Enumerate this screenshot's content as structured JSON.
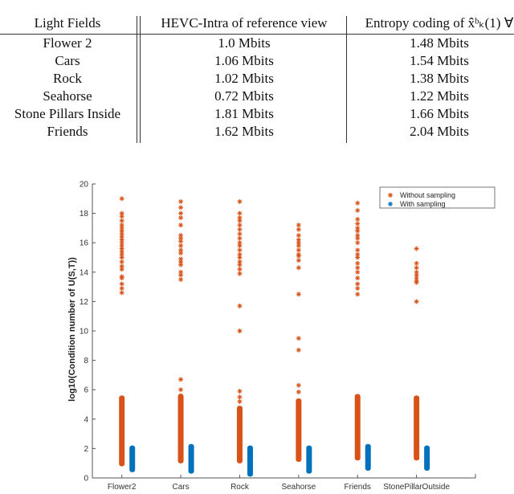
{
  "table": {
    "headers": [
      "Light Fields",
      "HEVC-Intra of reference view",
      "Entropy coding of x̂̂ᵇₖ(1) ∀"
    ],
    "rows": [
      [
        "Flower 2",
        "1.0 Mbits",
        "1.48 Mbits"
      ],
      [
        "Cars",
        "1.06 Mbits",
        "1.54 Mbits"
      ],
      [
        "Rock",
        "1.02 Mbits",
        "1.38 Mbits"
      ],
      [
        "Seahorse",
        "0.72 Mbits",
        "1.22 Mbits"
      ],
      [
        "Stone Pillars Inside",
        "1.81 Mbits",
        "1.66 Mbits"
      ],
      [
        "Friends",
        "1.62 Mbits",
        "2.04 Mbits"
      ]
    ]
  },
  "chart_data": {
    "type": "scatter",
    "title": "",
    "xlabel": "",
    "ylabel": "log10(Condition number of U(S,T))",
    "categories": [
      "Flower2",
      "Cars",
      "Rock",
      "Seahorse",
      "Friends",
      "StonePillarOutside"
    ],
    "xlim": [
      0.5,
      7
    ],
    "ylim": [
      0,
      20
    ],
    "yticks": [
      0,
      2,
      4,
      6,
      8,
      10,
      12,
      14,
      16,
      18,
      20
    ],
    "legend": {
      "placement": "top-right",
      "entries": [
        "Without sampling",
        "With sampling"
      ]
    },
    "colors": {
      "without": "#D95319",
      "with": "#0072BD",
      "axis": "#555555"
    },
    "series": [
      {
        "name": "Without sampling",
        "dense_ranges": [
          [
            0.9,
            5.5
          ],
          [
            1.1,
            5.6
          ],
          [
            1.1,
            4.8
          ],
          [
            1.2,
            5.3
          ],
          [
            1.3,
            5.6
          ],
          [
            1.3,
            5.5
          ]
        ],
        "outliers": [
          [
            19.0,
            18.0,
            17.8,
            17.5,
            17.2,
            17.0,
            16.8,
            16.6,
            16.4,
            16.2,
            16.0,
            15.8,
            15.6,
            15.4,
            15.2,
            15.0,
            14.7,
            14.4,
            14.2,
            13.7,
            13.6,
            13.2,
            12.9,
            12.6
          ],
          [
            18.8,
            18.4,
            18.0,
            17.7,
            17.2,
            16.5,
            16.3,
            16.1,
            15.8,
            15.5,
            15.3,
            14.9,
            14.7,
            14.5,
            14.0,
            13.8,
            13.5,
            6.7,
            6.0,
            5.6
          ],
          [
            18.8,
            18.0,
            17.7,
            17.5,
            17.2,
            16.9,
            16.6,
            16.3,
            16.0,
            15.8,
            15.5,
            15.2,
            15.0,
            14.7,
            14.5,
            14.2,
            13.9,
            11.7,
            10.0,
            5.9,
            5.5,
            5.2
          ],
          [
            17.2,
            16.9,
            16.5,
            16.2,
            16.0,
            15.8,
            15.5,
            15.2,
            15.1,
            14.8,
            14.3,
            12.5,
            9.5,
            8.7,
            6.3,
            5.85
          ],
          [
            18.7,
            18.2,
            17.6,
            17.3,
            17.0,
            16.8,
            16.5,
            16.3,
            16.0,
            15.5,
            15.2,
            15.0,
            14.6,
            14.3,
            14.0,
            13.6,
            13.2,
            12.9,
            12.5
          ],
          [
            15.6,
            14.6,
            14.3,
            14.0,
            13.8,
            13.6,
            13.4,
            13.3,
            12.0
          ]
        ]
      },
      {
        "name": "With sampling",
        "dense_ranges": [
          [
            0.5,
            2.1
          ],
          [
            0.4,
            2.2
          ],
          [
            0.2,
            2.1
          ],
          [
            0.4,
            2.1
          ],
          [
            0.6,
            2.2
          ],
          [
            0.6,
            2.1
          ]
        ],
        "outliers": [
          [],
          [],
          [],
          [],
          [],
          []
        ]
      }
    ]
  }
}
